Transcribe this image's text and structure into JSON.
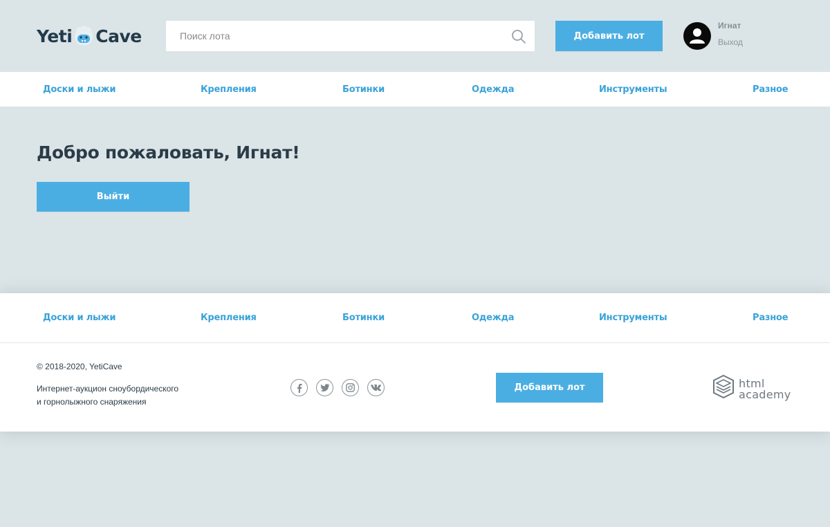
{
  "header": {
    "logo": {
      "left": "Yeti",
      "right": "Cave"
    },
    "search": {
      "placeholder": "Поиск лота",
      "value": ""
    },
    "add_lot_label": "Добавить лот",
    "user": {
      "name": "Игнат",
      "logout": "Выход"
    }
  },
  "nav": {
    "items": [
      {
        "label": "Доски и лыжи"
      },
      {
        "label": "Крепления"
      },
      {
        "label": "Ботинки"
      },
      {
        "label": "Одежда"
      },
      {
        "label": "Инструменты"
      },
      {
        "label": "Разное"
      }
    ]
  },
  "main": {
    "welcome": "Добро пожаловать, Игнат!",
    "logout_button": "Выйти"
  },
  "footer": {
    "copyright": "© 2018-2020, YetiCave",
    "about_line1": "Интернет-аукцион сноубордического",
    "about_line2": "и горнолыжного снаряжения",
    "socials": [
      "facebook-icon",
      "twitter-icon",
      "instagram-icon",
      "vk-icon"
    ],
    "add_lot_label": "Добавить лот",
    "academy": {
      "line1": "html",
      "line2": "academy"
    }
  },
  "colors": {
    "accent": "#4baee3",
    "link": "#3aa2d9",
    "background": "#dbe4e7",
    "text": "#2b3c48"
  }
}
